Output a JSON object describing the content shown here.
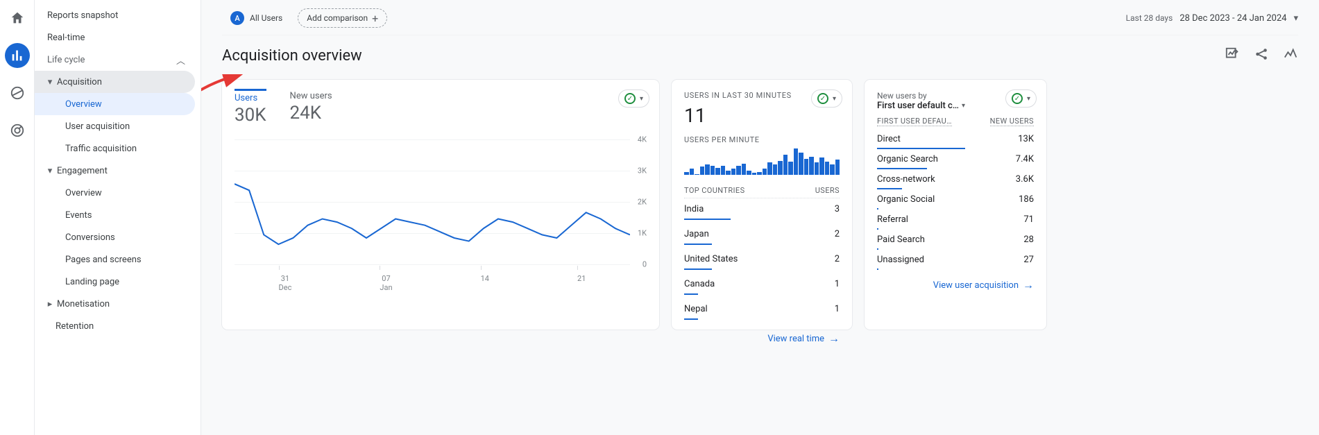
{
  "rail": {
    "items": [
      "home",
      "reports",
      "explore",
      "advertising"
    ]
  },
  "sidebar": {
    "reports_snapshot": "Reports snapshot",
    "realtime": "Real-time",
    "life_cycle": "Life cycle",
    "acquisition": "Acquisition",
    "acq_overview": "Overview",
    "user_acquisition": "User acquisition",
    "traffic_acquisition": "Traffic acquisition",
    "engagement": "Engagement",
    "eng_overview": "Overview",
    "events": "Events",
    "conversions": "Conversions",
    "pages_screens": "Pages and screens",
    "landing_page": "Landing page",
    "monetisation": "Monetisation",
    "retention": "Retention"
  },
  "topbar": {
    "audience_letter": "A",
    "audience_label": "All Users",
    "add_comparison": "Add comparison",
    "period": "Last 28 days",
    "date_range": "28 Dec 2023 - 24 Jan 2024"
  },
  "page_title": "Acquisition overview",
  "card_a": {
    "tabs": [
      {
        "label": "Users",
        "value": "30K",
        "active": true
      },
      {
        "label": "New users",
        "value": "24K",
        "active": false
      }
    ],
    "y_ticks": [
      "4K",
      "3K",
      "2K",
      "1K",
      "0"
    ],
    "x_ticks": [
      {
        "line1": "31",
        "line2": "Dec"
      },
      {
        "line1": "07",
        "line2": "Jan"
      },
      {
        "line1": "14",
        "line2": ""
      },
      {
        "line1": "21",
        "line2": ""
      }
    ]
  },
  "chart_data": {
    "type": "line",
    "title": "Users",
    "x": [
      "28 Dec",
      "29 Dec",
      "30 Dec",
      "31 Dec",
      "01 Jan",
      "02 Jan",
      "03 Jan",
      "04 Jan",
      "05 Jan",
      "06 Jan",
      "07 Jan",
      "08 Jan",
      "09 Jan",
      "10 Jan",
      "11 Jan",
      "12 Jan",
      "13 Jan",
      "14 Jan",
      "15 Jan",
      "16 Jan",
      "17 Jan",
      "18 Jan",
      "19 Jan",
      "20 Jan",
      "21 Jan",
      "22 Jan",
      "23 Jan",
      "24 Jan"
    ],
    "values": [
      2600,
      2400,
      1000,
      700,
      900,
      1300,
      1500,
      1400,
      1200,
      900,
      1200,
      1500,
      1400,
      1300,
      1100,
      900,
      800,
      1200,
      1500,
      1400,
      1200,
      1000,
      900,
      1300,
      1700,
      1500,
      1200,
      1000
    ],
    "ylim": [
      0,
      4000
    ],
    "y_ticks": [
      0,
      1000,
      2000,
      3000,
      4000
    ],
    "xlabel": "",
    "ylabel": ""
  },
  "card_b": {
    "title": "USERS IN LAST 30 MINUTES",
    "value": "11",
    "sub_title": "USERS PER MINUTE",
    "bars": [
      3,
      6,
      1,
      8,
      10,
      9,
      7,
      9,
      4,
      6,
      9,
      11,
      4,
      2,
      3,
      6,
      12,
      10,
      14,
      20,
      13,
      26,
      22,
      16,
      18,
      12,
      17,
      13,
      10,
      15
    ],
    "table_head_left": "TOP COUNTRIES",
    "table_head_right": "USERS",
    "rows": [
      {
        "label": "India",
        "value": "3",
        "bar_pct": 30
      },
      {
        "label": "Japan",
        "value": "2",
        "bar_pct": 18
      },
      {
        "label": "United States",
        "value": "2",
        "bar_pct": 18
      },
      {
        "label": "Canada",
        "value": "1",
        "bar_pct": 9
      },
      {
        "label": "Nepal",
        "value": "1",
        "bar_pct": 9
      }
    ],
    "link": "View real time"
  },
  "card_c": {
    "by_label": "New users by",
    "by_value": "First user default c…",
    "head_left": "FIRST USER DEFAU…",
    "head_right": "NEW USERS",
    "rows": [
      {
        "label": "Direct",
        "value": "13K",
        "bar_pct": 56
      },
      {
        "label": "Organic Search",
        "value": "7.4K",
        "bar_pct": 32
      },
      {
        "label": "Cross-network",
        "value": "3.6K",
        "bar_pct": 16
      },
      {
        "label": "Organic Social",
        "value": "186",
        "bar_pct": 1
      },
      {
        "label": "Referral",
        "value": "71",
        "bar_pct": 1
      },
      {
        "label": "Paid Search",
        "value": "28",
        "bar_pct": 1
      },
      {
        "label": "Unassigned",
        "value": "27",
        "bar_pct": 1
      }
    ],
    "link": "View user acquisition"
  }
}
